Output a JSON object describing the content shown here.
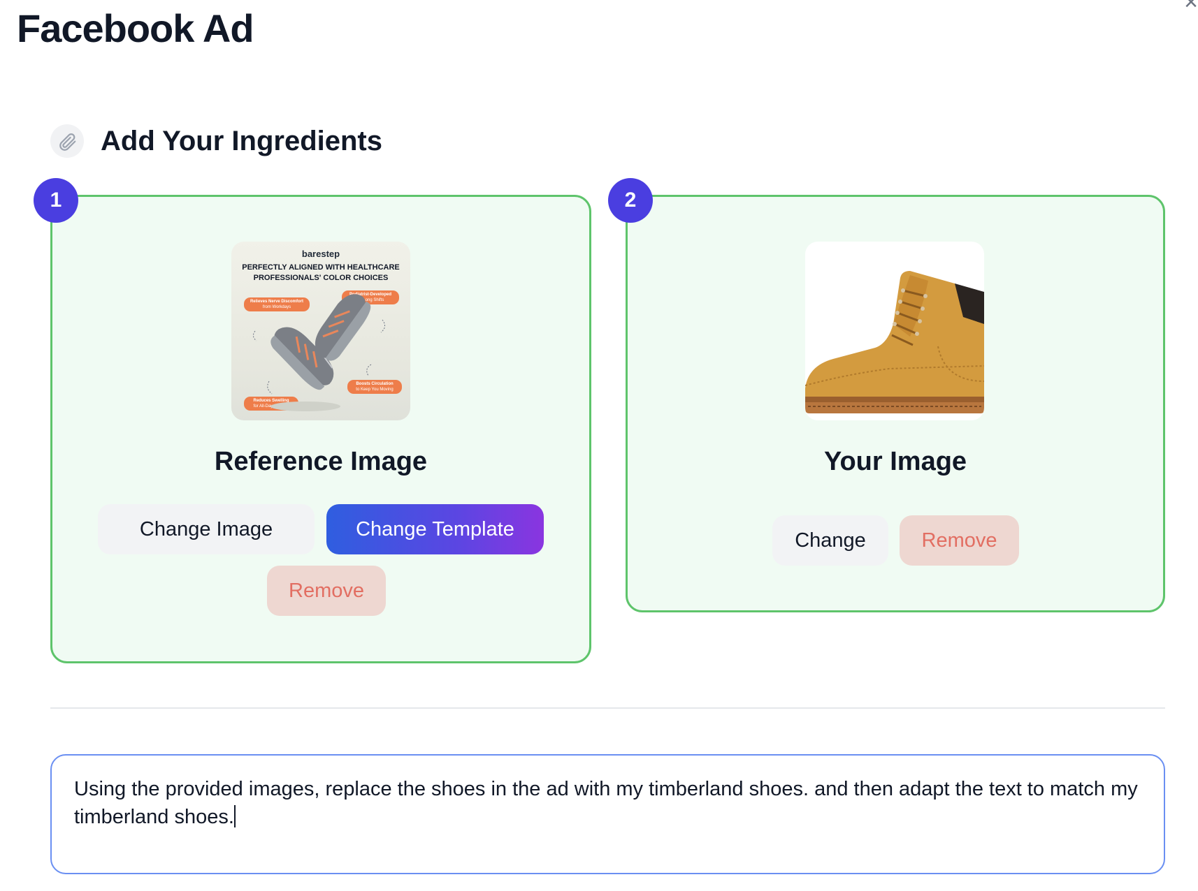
{
  "page": {
    "title": "Facebook Ad",
    "close_glyph": "×"
  },
  "section": {
    "title": "Add Your Ingredients",
    "icon": "paperclip-icon"
  },
  "steps": {
    "step1": "1",
    "step2": "2"
  },
  "reference_card": {
    "label": "Reference Image",
    "thumbnail": {
      "brand": "barestep",
      "headline": "PERFECTLY ALIGNED WITH HEALTHCARE PROFESSIONALS' COLOR CHOICES",
      "callouts": [
        {
          "bold": "Relieves Nerve Discomfort",
          "rest": "from Workdays"
        },
        {
          "bold": "Podiatrist-Developed",
          "rest": "for Long Shifts"
        },
        {
          "bold": "Boosts Circulation",
          "rest": "to Keep You Moving"
        },
        {
          "bold": "Reduces Swelling",
          "rest": "for All-Day Comfort"
        }
      ]
    },
    "buttons": {
      "change_image": "Change Image",
      "change_template": "Change Template",
      "remove": "Remove"
    }
  },
  "your_card": {
    "label": "Your Image",
    "buttons": {
      "change": "Change",
      "remove": "Remove"
    }
  },
  "prompt": {
    "text": "Using the provided images, replace the shoes in the ad with my timberland shoes. and then adapt the text to match my timberland shoes."
  },
  "colors": {
    "accent_badge": "#4a3ee0",
    "card_border": "#5ec46b",
    "card_bg": "#f0fbf3",
    "remove_bg": "#eed7d1",
    "remove_text": "#e26e62",
    "prompt_border": "#6a8ff2"
  }
}
